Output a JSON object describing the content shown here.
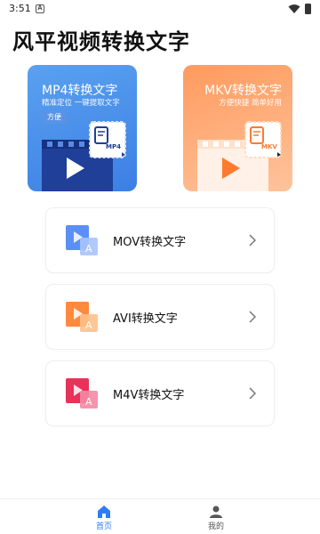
{
  "status_bar": {
    "time": "3:51",
    "notification_glyph": "A"
  },
  "app": {
    "title": "风平视频转换文字"
  },
  "feature_cards": [
    {
      "title": "MP4转换文字",
      "subtitle": "精准定位 一键提取文字",
      "tag": "方便",
      "badge": "MP4",
      "color": "#3c7fe4"
    },
    {
      "title": "MKV转换文字",
      "subtitle": "方便快捷 简单好用",
      "badge": "MKV",
      "color": "#ff9a5e"
    }
  ],
  "rows": [
    {
      "label": "MOV转换文字",
      "icon": "video-text-icon",
      "color": "#5b8ff5"
    },
    {
      "label": "AVI转换文字",
      "icon": "video-text-icon",
      "color": "#ff8a3d"
    },
    {
      "label": "M4V转换文字",
      "icon": "video-text-icon",
      "color": "#e8325a"
    }
  ],
  "bottom_nav": [
    {
      "label": "首页",
      "icon": "home-icon",
      "active": true
    },
    {
      "label": "我的",
      "icon": "user-icon",
      "active": false
    }
  ]
}
